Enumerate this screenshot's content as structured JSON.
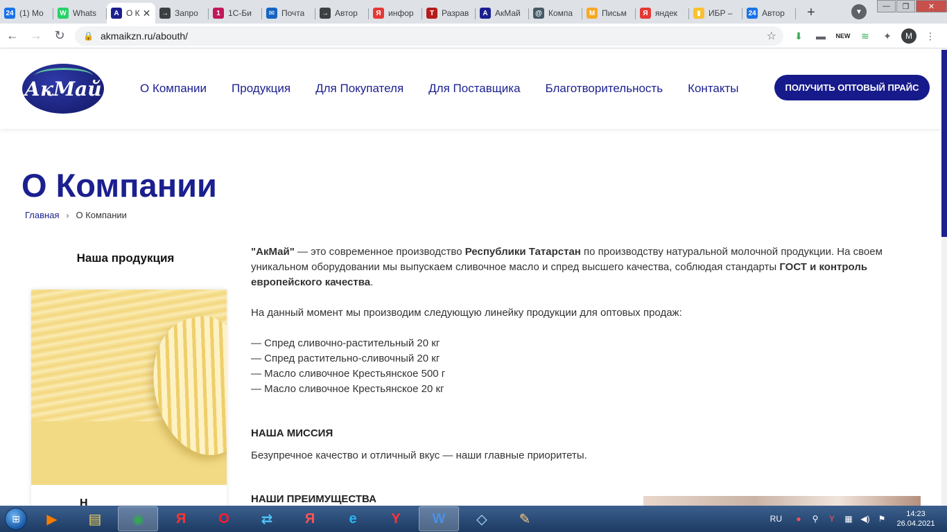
{
  "browser": {
    "tabs": [
      {
        "label": "(1) Mo",
        "fav": "24",
        "color": "#1a73e8",
        "active": false
      },
      {
        "label": "Whats",
        "fav": "W",
        "color": "#25d366",
        "active": false
      },
      {
        "label": "О К",
        "fav": "A",
        "color": "#1b1f8f",
        "active": true
      },
      {
        "label": "Запро",
        "fav": "→",
        "color": "#3c4043",
        "active": false
      },
      {
        "label": "1С-Би",
        "fav": "1",
        "color": "#c2185b",
        "active": false
      },
      {
        "label": "Почта",
        "fav": "✉",
        "color": "#1565c0",
        "active": false
      },
      {
        "label": "Автор",
        "fav": "→",
        "color": "#3c4043",
        "active": false
      },
      {
        "label": "инфор",
        "fav": "Я",
        "color": "#e53935",
        "active": false
      },
      {
        "label": "Разрав",
        "fav": "Т",
        "color": "#b71c1c",
        "active": false
      },
      {
        "label": "АкМай",
        "fav": "A",
        "color": "#1b1f8f",
        "active": false
      },
      {
        "label": "Компа",
        "fav": "@",
        "color": "#455a64",
        "active": false
      },
      {
        "label": "Письм",
        "fav": "M",
        "color": "#f9a825",
        "active": false
      },
      {
        "label": "яндек",
        "fav": "Я",
        "color": "#e53935",
        "active": false
      },
      {
        "label": "ИБР –",
        "fav": "▮",
        "color": "#fbc02d",
        "active": false
      },
      {
        "label": "Автор",
        "fav": "24",
        "color": "#1a73e8",
        "active": false
      }
    ],
    "url": "akmaikzn.ru/abouth/",
    "profile_initial": "M"
  },
  "site": {
    "logo_text": "АкМай",
    "nav": [
      "О Компании",
      "Продукция",
      "Для Покупателя",
      "Для Поставщика",
      "Благотворительность",
      "Контакты"
    ],
    "cta": "ПОЛУЧИТЬ ОПТОВЫЙ ПРАЙС"
  },
  "page": {
    "title": "О Компании",
    "breadcrumb": {
      "home": "Главная",
      "current": "О Компании"
    },
    "sidebar_title": "Наша продукция",
    "sidebar_caption": "Н",
    "intro": {
      "brand": "\"АкМай\"",
      "t1": " — это современное производство ",
      "region": "Республики Татарстан",
      "t2": " по производству натуральной молочной продукции. На своем уникальном оборудовании мы выпускаем сливочное масло и спред высшего качества, соблюдая стандарты ",
      "standard": "ГОСТ и контроль европейского качества",
      "t3": "."
    },
    "lineup_intro": "На данный момент мы производим следующую линейку продукции для оптовых продаж:",
    "products": [
      "— Спред сливочно-растительный 20 кг",
      "— Спред растительно-сливочный 20 кг",
      "— Масло сливочное Крестьянское 500 г",
      "— Масло сливочное Крестьянское 20 кг"
    ],
    "mission_heading": "НАША МИССИЯ",
    "mission_text": "Безупречное качество и отличный вкус — наши главные приоритеты.",
    "advantages_heading": "НАШИ ПРЕИМУЩЕСТВА"
  },
  "taskbar": {
    "lang": "RU",
    "time": "14:23",
    "date": "26.04.2021"
  }
}
